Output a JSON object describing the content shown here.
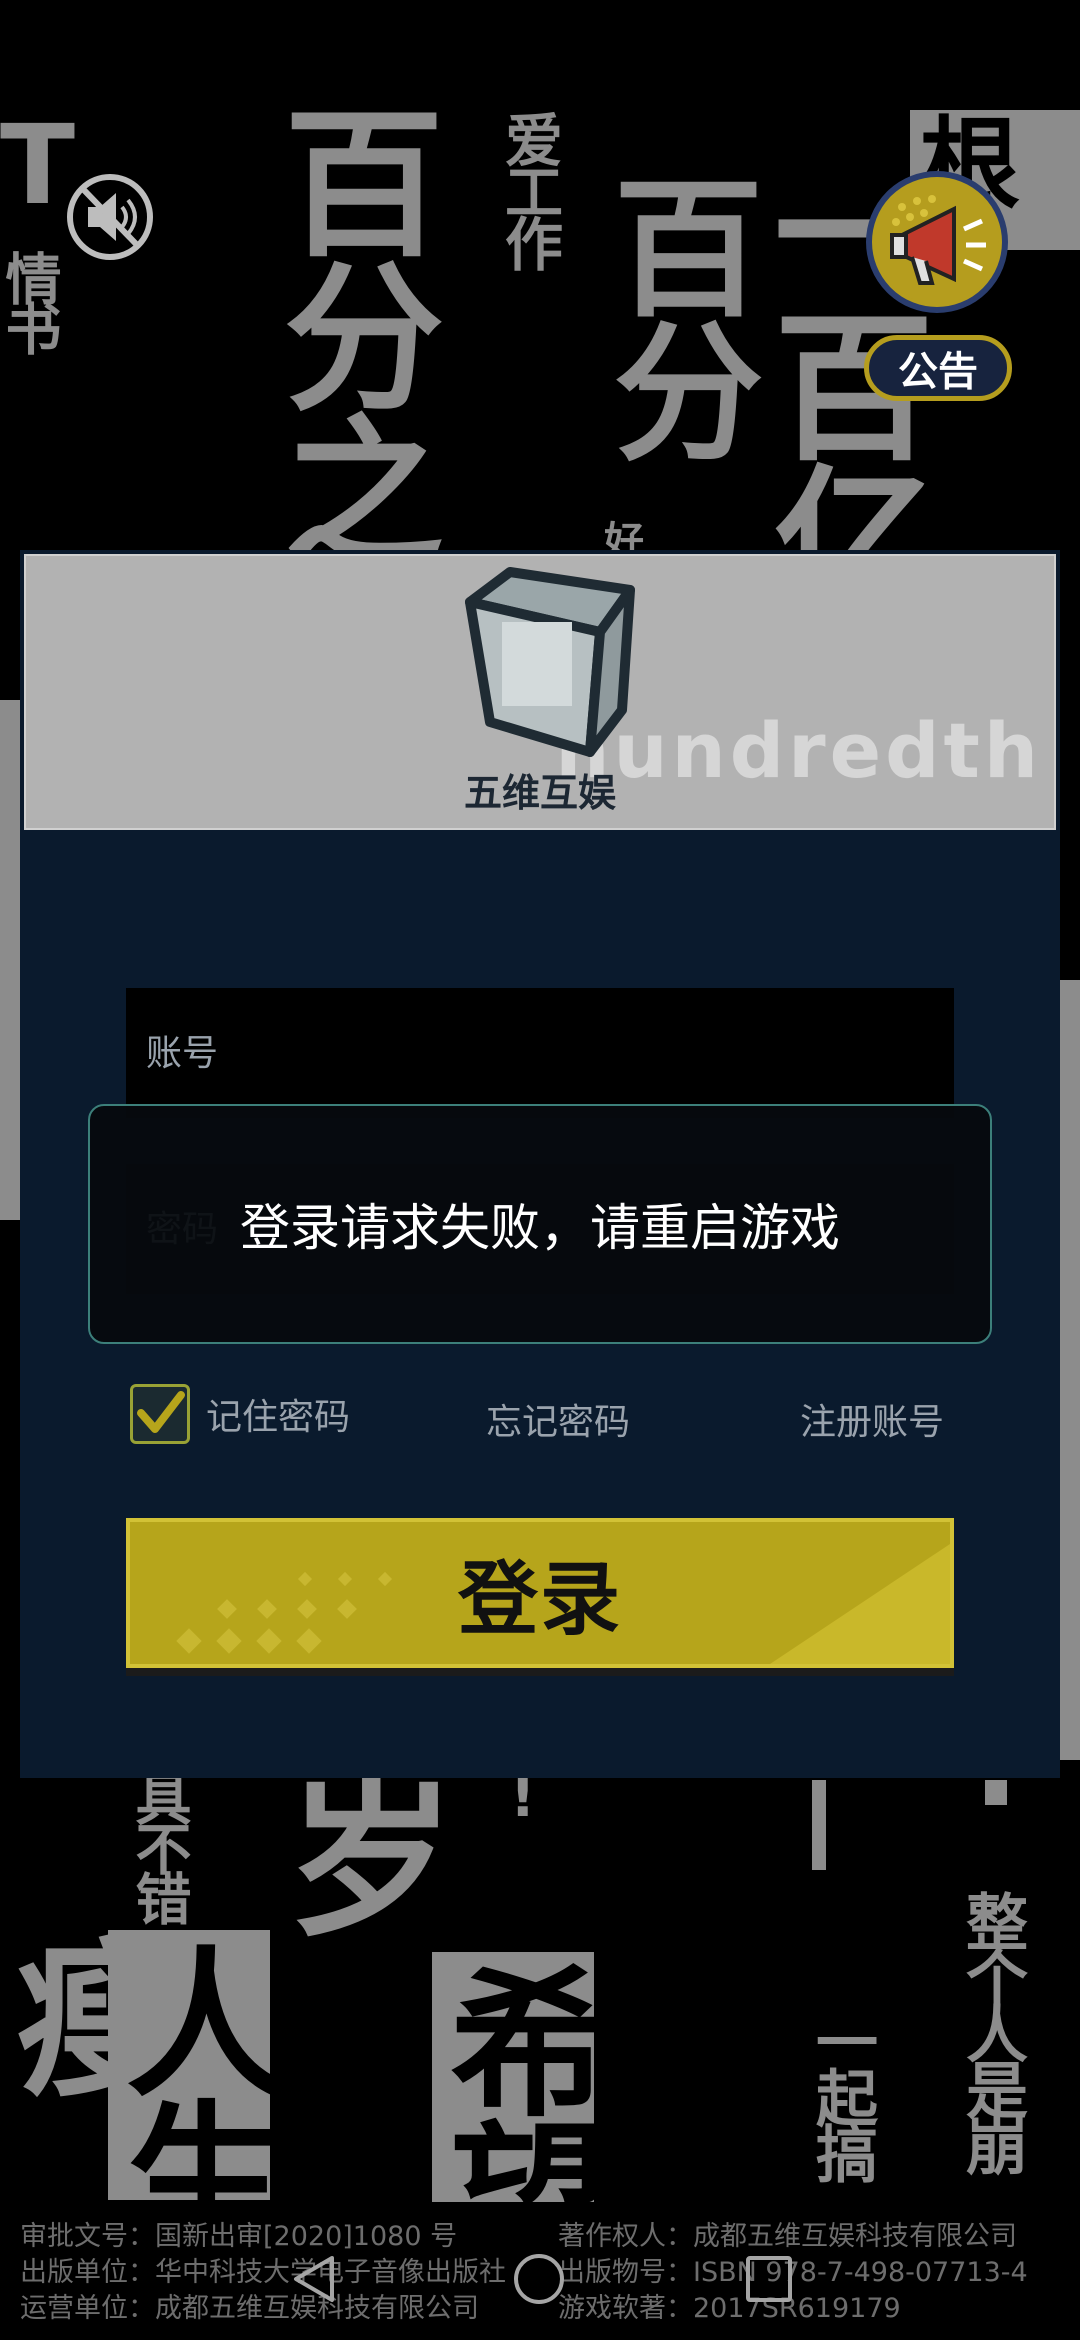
{
  "background": {
    "words": [
      "百分之",
      "爱工作",
      "百分",
      "一百亿",
      "T",
      "情书",
      "一个根",
      "岁",
      "具不错",
      "瘦人生",
      "人生",
      "希望",
      "整个人是崩",
      "一起搞",
      "好"
    ]
  },
  "notice": {
    "label": "公告",
    "icon": "megaphone-icon"
  },
  "mute": {
    "icon": "speaker-muted-icon"
  },
  "banner": {
    "brand": "五维互娱",
    "deco_text": "hundredth"
  },
  "login": {
    "account_placeholder": "账号",
    "password_placeholder": "密码",
    "remember_label": "记住密码",
    "remember_checked": true,
    "forgot_label": "忘记密码",
    "register_label": "注册账号",
    "login_label": "登录"
  },
  "toast": {
    "message": "登录请求失败，请重启游戏"
  },
  "legal": {
    "approval": "审批文号：国新出审[2020]1080 号",
    "publisher": "出版单位：华中科技大学电子音像出版社",
    "operator": "运营单位：成都五维互娱科技有限公司",
    "copyright": "著作权人：成都五维互娱科技有限公司",
    "isbn": "出版物号：ISBN 978-7-498-07713-4",
    "software": "游戏软著：2017SR619179"
  },
  "colors": {
    "accent_yellow": "#b6a51b",
    "panel_bg": "#0a1a2d",
    "toast_border": "#3c7f7a"
  }
}
